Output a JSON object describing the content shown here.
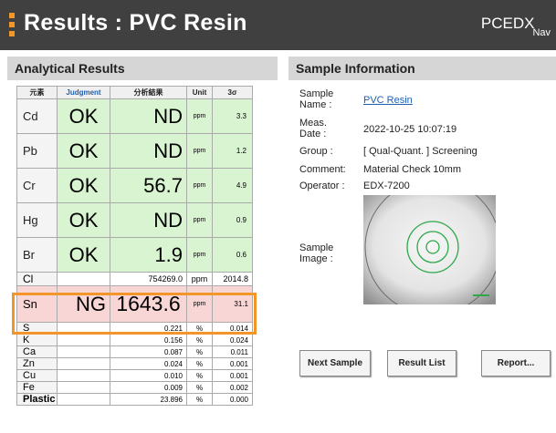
{
  "header": {
    "title": "Results : PVC Resin",
    "brand": "PCEDX",
    "brand_sub": "Nav",
    "accent_color": "#f3962a"
  },
  "analytical": {
    "heading": "Analytical Results",
    "columns": {
      "element": "元素",
      "judgment": "Judgment",
      "result": "分析結果",
      "unit": "Unit",
      "sigma": "3σ"
    },
    "main_rows": [
      {
        "el": "Cd",
        "judgment": "OK",
        "result": "ND",
        "unit": "ppm",
        "sigma": "3.3"
      },
      {
        "el": "Pb",
        "judgment": "OK",
        "result": "ND",
        "unit": "ppm",
        "sigma": "1.2"
      },
      {
        "el": "Cr",
        "judgment": "OK",
        "result": "56.7",
        "unit": "ppm",
        "sigma": "4.9"
      },
      {
        "el": "Hg",
        "judgment": "OK",
        "result": "ND",
        "unit": "ppm",
        "sigma": "0.9"
      },
      {
        "el": "Br",
        "judgment": "OK",
        "result": "1.9",
        "unit": "ppm",
        "sigma": "0.6"
      }
    ],
    "cl_row": {
      "el": "Cl",
      "judgment": "",
      "result": "754269.0",
      "unit": "ppm",
      "sigma": "2014.8"
    },
    "ng_row": {
      "el": "Sn",
      "judgment": "NG",
      "result": "1643.6",
      "unit": "ppm",
      "sigma": "31.1"
    },
    "minor_rows": [
      {
        "el": "S",
        "result": "0.221",
        "unit": "%",
        "sigma": "0.014"
      },
      {
        "el": "K",
        "result": "0.156",
        "unit": "%",
        "sigma": "0.024"
      },
      {
        "el": "Ca",
        "result": "0.087",
        "unit": "%",
        "sigma": "0.011"
      },
      {
        "el": "Zn",
        "result": "0.024",
        "unit": "%",
        "sigma": "0.001"
      },
      {
        "el": "Cu",
        "result": "0.010",
        "unit": "%",
        "sigma": "0.001"
      },
      {
        "el": "Fe",
        "result": "0.009",
        "unit": "%",
        "sigma": "0.002"
      },
      {
        "el": "Plastic",
        "result": "23.896",
        "unit": "%",
        "sigma": "0.000"
      }
    ]
  },
  "sample": {
    "heading": "Sample Information",
    "name_label_1": "Sample",
    "name_label_2": "Name :",
    "name_value": "PVC Resin",
    "date_label_1": "Meas.",
    "date_label_2": "Date :",
    "date_value": "2022-10-25 10:07:19",
    "group_label": "Group :",
    "group_value": "[ Qual-Quant. ] Screening",
    "comment_label": "Comment:",
    "comment_value": "Material Check 10mm",
    "operator_label": "Operator :",
    "operator_value": "EDX-7200",
    "image_label_1": "Sample",
    "image_label_2": "Image :"
  },
  "buttons": {
    "next": "Next Sample",
    "list": "Result List",
    "report": "Report..."
  }
}
